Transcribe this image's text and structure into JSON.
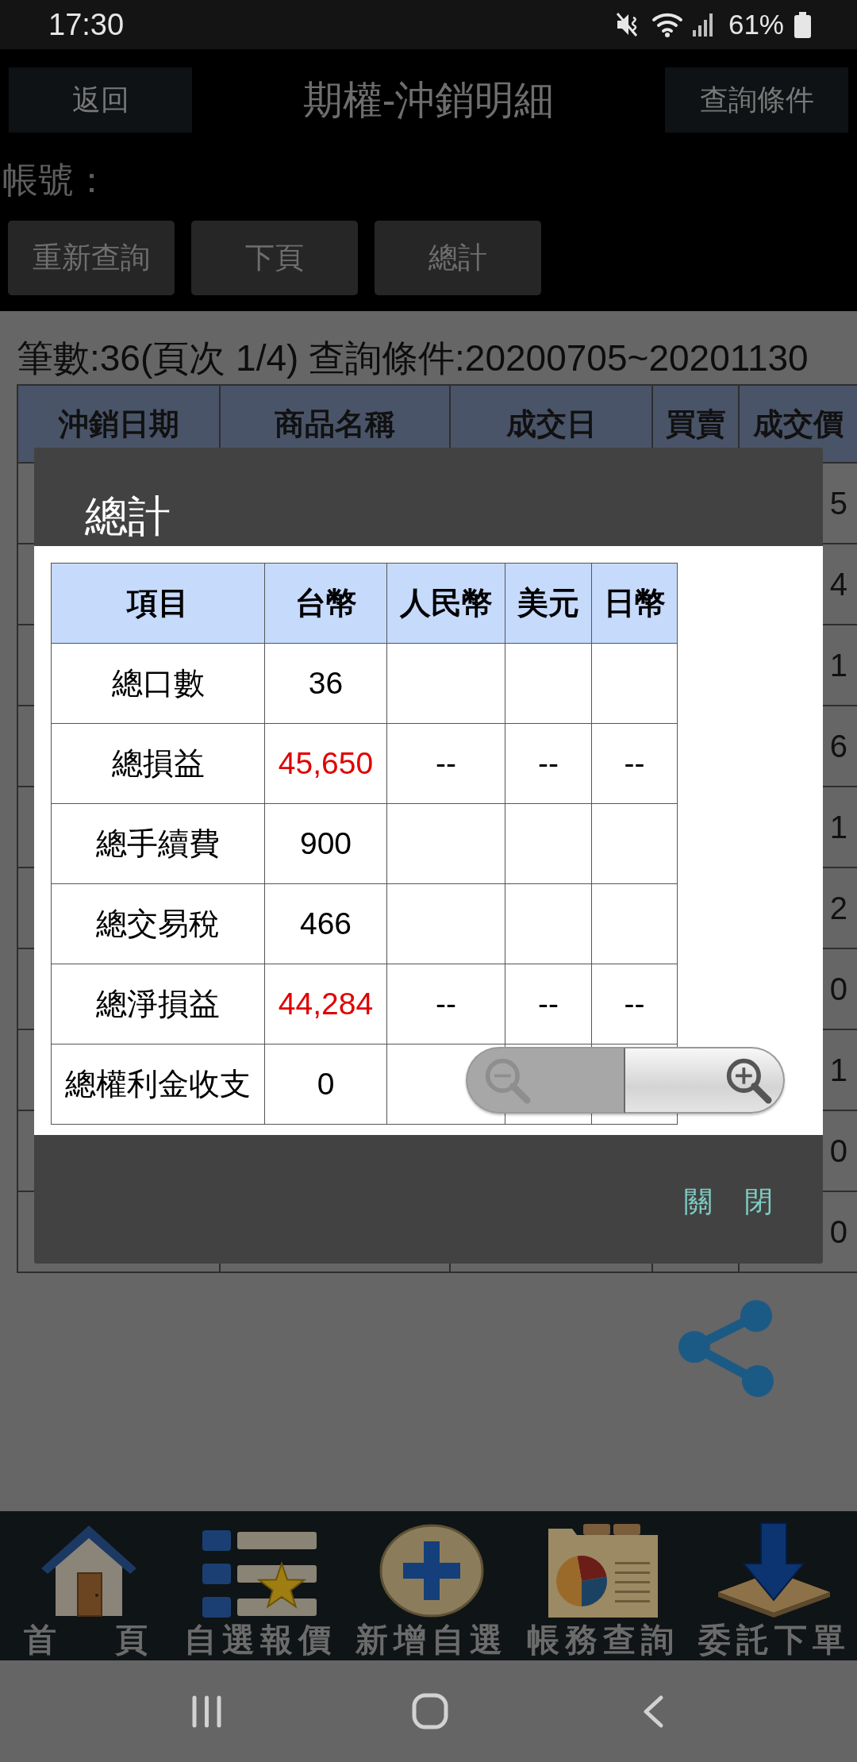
{
  "status_bar": {
    "time": "17:30",
    "battery": "61%"
  },
  "header": {
    "back_button": "返回",
    "title": "期權-沖銷明細",
    "query_button": "查詢條件"
  },
  "account_label": "帳號：",
  "actions": [
    "重新查詢",
    "下頁",
    "總計"
  ],
  "summary": "筆數:36(頁次 1/4) 查詢條件:20200705~20201130",
  "table": {
    "columns": [
      "沖銷日期",
      "商品名稱",
      "成交日",
      "買賣",
      "成交價"
    ],
    "rows": [
      {
        "price": "5"
      },
      {
        "price": "4"
      },
      {
        "price": "1"
      },
      {
        "price": "6"
      },
      {
        "price": "1"
      },
      {
        "price": "2"
      },
      {
        "price": "0"
      },
      {
        "price": "1"
      },
      {
        "price": "0"
      },
      {
        "price": "0"
      }
    ]
  },
  "dialog": {
    "title": "總計",
    "table": {
      "columns": [
        "項目",
        "台幣",
        "人民幣",
        "美元",
        "日幣"
      ],
      "rows": [
        {
          "item": "總口數",
          "twd": "36",
          "color": "#000000"
        },
        {
          "item": "總損益",
          "twd": "45,650",
          "cny": "--",
          "usd": "--",
          "jpy": "--",
          "color": "#e00000"
        },
        {
          "item": "總手續費",
          "twd": "900",
          "color": "#000000"
        },
        {
          "item": "總交易稅",
          "twd": "466",
          "color": "#000000"
        },
        {
          "item": "總淨損益",
          "twd": "44,284",
          "cny": "--",
          "usd": "--",
          "jpy": "--",
          "color": "#e00000"
        },
        {
          "item": "總權利金收支",
          "twd": "0",
          "color": "#000000"
        }
      ]
    },
    "close_button": "關 閉"
  },
  "zoom_control": {
    "zoom_out": {
      "disabled": true
    },
    "zoom_in": {
      "disabled": false
    }
  },
  "bottom_nav": [
    {
      "kind": "home",
      "label": "首 頁"
    },
    {
      "kind": "watchlist",
      "label": "自選報價"
    },
    {
      "kind": "add",
      "label": "新增自選"
    },
    {
      "kind": "account",
      "label": "帳務查詢"
    },
    {
      "kind": "order",
      "label": "委託下單"
    }
  ]
}
